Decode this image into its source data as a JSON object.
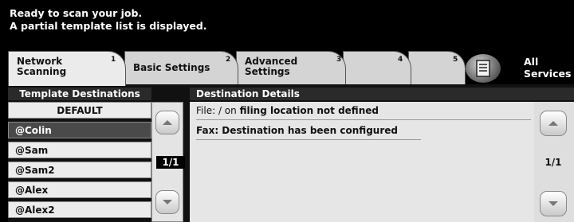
{
  "status": {
    "line1": "Ready to scan your job.",
    "line2": "A partial template list is displayed."
  },
  "tabs": [
    {
      "label_line1": "Network",
      "label_line2": "Scanning",
      "number": "1",
      "active": true
    },
    {
      "label_line1": "Basic Settings",
      "label_line2": "",
      "number": "2",
      "active": false
    },
    {
      "label_line1": "Advanced",
      "label_line2": "Settings",
      "number": "3",
      "active": false
    },
    {
      "label_line1": "",
      "label_line2": "",
      "number": "4",
      "active": false
    },
    {
      "label_line1": "",
      "label_line2": "",
      "number": "5",
      "active": false
    }
  ],
  "services": {
    "line1": "All",
    "line2": "Services",
    "icon": "services-icon"
  },
  "template_destinations": {
    "header": "Template Destinations",
    "items": [
      {
        "label": "DEFAULT",
        "selected": false
      },
      {
        "label": "@Colin",
        "selected": true
      },
      {
        "label": "@Sam",
        "selected": false
      },
      {
        "label": "@Sam2",
        "selected": false
      },
      {
        "label": "@Alex",
        "selected": false
      },
      {
        "label": "@Alex2",
        "selected": false
      }
    ],
    "page_indicator": "1/1"
  },
  "destination_details": {
    "header": "Destination Details",
    "file_line": {
      "prefix": "File: / on ",
      "bold": "filing location not defined"
    },
    "fax_line": "Fax: Destination has been configured",
    "page_indicator": "1/1"
  },
  "icons": {
    "scroll_up": "scroll-up-icon",
    "scroll_down": "scroll-down-icon"
  },
  "colors": {
    "background": "#000000",
    "tab_active": "#ebebeb",
    "tab_inactive": "#d4d4d4",
    "selected_row": "#4a4a4a"
  }
}
